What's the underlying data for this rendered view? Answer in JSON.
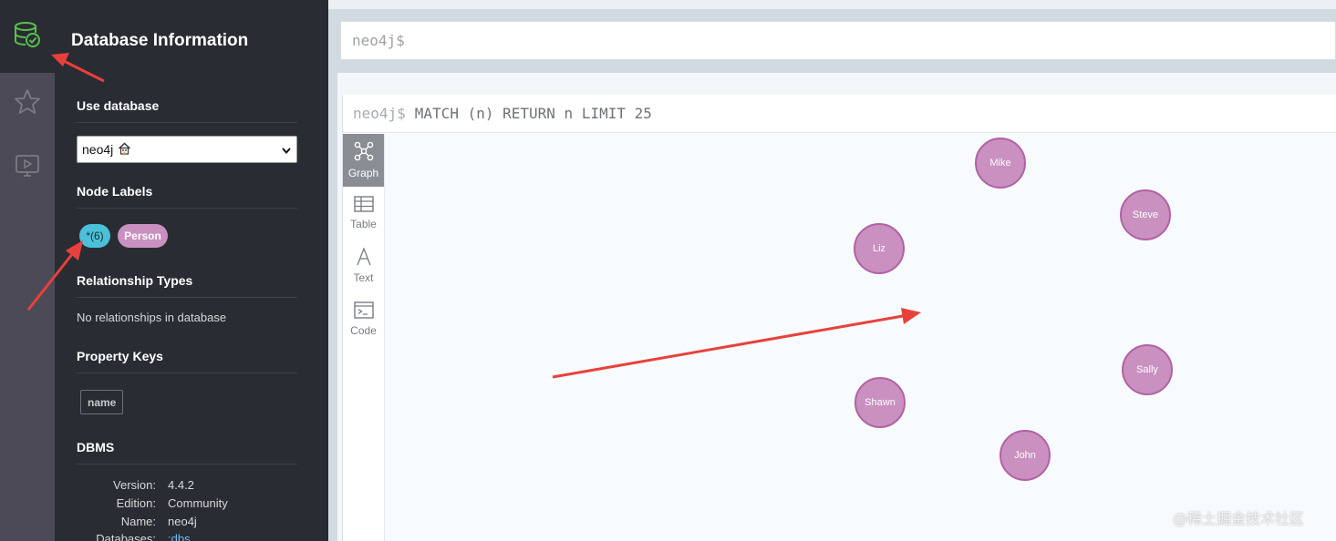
{
  "rail": {
    "items": [
      {
        "icon": "database-check-icon",
        "active": true
      },
      {
        "icon": "star-icon",
        "active": false
      },
      {
        "icon": "play-monitor-icon",
        "active": false
      }
    ]
  },
  "drawer": {
    "title": "Database Information",
    "use_database": {
      "heading": "Use database",
      "selected": "neo4j",
      "home_icon": "home-icon"
    },
    "node_labels": {
      "heading": "Node Labels",
      "pills": [
        {
          "label": "*(6)",
          "color": "#4bc0d9"
        },
        {
          "label": "Person",
          "color": "#c990c0"
        }
      ]
    },
    "relationship_types": {
      "heading": "Relationship Types",
      "empty_text": "No relationships in database"
    },
    "property_keys": {
      "heading": "Property Keys",
      "keys": [
        "name"
      ]
    },
    "dbms": {
      "heading": "DBMS",
      "rows": [
        {
          "key": "Version:",
          "value": "4.4.2"
        },
        {
          "key": "Edition:",
          "value": "Community"
        },
        {
          "key": "Name:",
          "value": "neo4j"
        },
        {
          "key": "Databases:",
          "value": ":dbs"
        }
      ]
    }
  },
  "editor": {
    "prompt": "neo4j$"
  },
  "frame": {
    "prompt": "neo4j$",
    "query": "MATCH (n) RETURN n LIMIT 25",
    "tabs": [
      {
        "label": "Graph",
        "icon": "graph-icon",
        "active": true
      },
      {
        "label": "Table",
        "icon": "table-icon",
        "active": false
      },
      {
        "label": "Text",
        "icon": "text-icon",
        "active": false
      },
      {
        "label": "Code",
        "icon": "code-icon",
        "active": false
      }
    ],
    "nodes": [
      "Mike",
      "Steve",
      "Liz",
      "Sally",
      "Shawn",
      "John"
    ],
    "node_color": "#c990c0"
  },
  "watermark": "@稀土掘金技术社区",
  "annotation_color": "#e8413c"
}
